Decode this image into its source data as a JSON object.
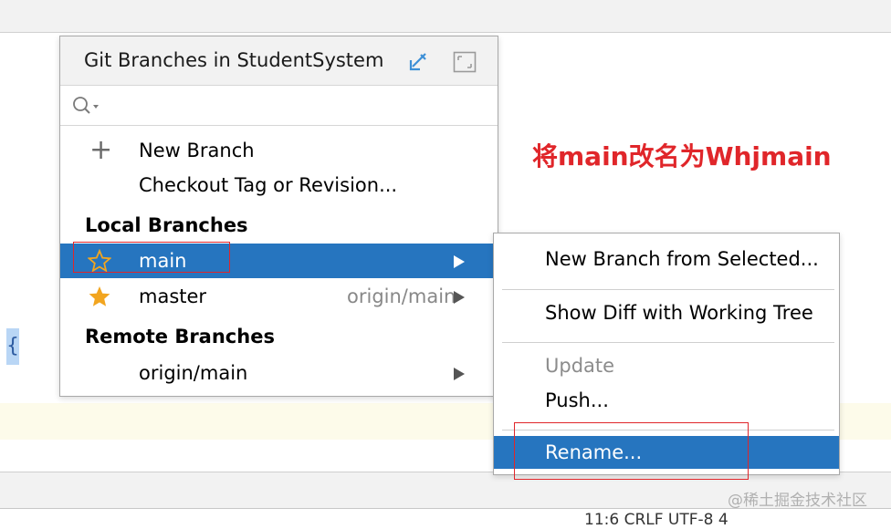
{
  "popup": {
    "title": "Git Branches in StudentSystem",
    "search_placeholder": "",
    "actions": [
      {
        "label": "New Branch",
        "icon": "plus-icon"
      },
      {
        "label": "Checkout Tag or Revision..."
      }
    ],
    "local_branches_header": "Local Branches",
    "local_branches": [
      {
        "name": "main",
        "tracking": "",
        "icon": "star-outline-icon",
        "selected": true
      },
      {
        "name": "master",
        "tracking": "origin/main",
        "icon": "star-filled-icon",
        "selected": false
      }
    ],
    "remote_branches_header": "Remote Branches",
    "remote_branches": [
      {
        "name": "origin/main"
      }
    ]
  },
  "submenu": {
    "items": [
      {
        "label": "New Branch from Selected...",
        "enabled": true
      },
      {
        "label": "Show Diff with Working Tree",
        "enabled": true
      },
      {
        "label": "Update",
        "enabled": false
      },
      {
        "label": "Push...",
        "enabled": true
      },
      {
        "label": "Rename...",
        "enabled": true,
        "selected": true
      }
    ]
  },
  "annotation": "将main改名为Whjmain",
  "editor": {
    "brace": "{"
  },
  "statusbar": {
    "text": "11:6   CRLF   UTF-8   4"
  },
  "watermark": "@稀土掘金技术社区",
  "colors": {
    "selection": "#2675bf",
    "annotation": "#e0262a",
    "star": "#f2a51f"
  }
}
